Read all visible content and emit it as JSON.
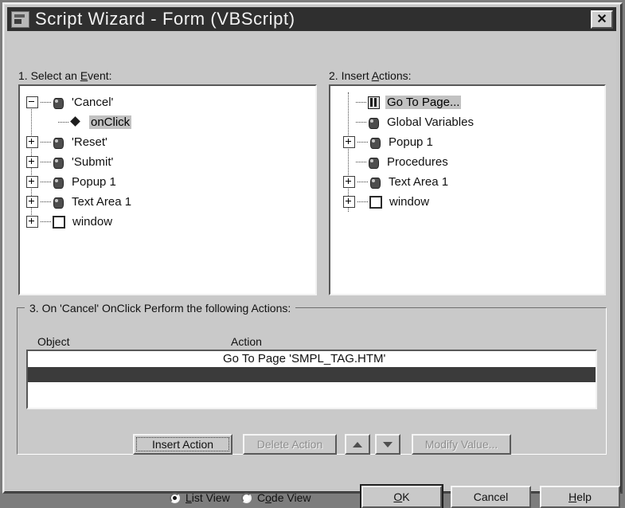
{
  "window": {
    "title": "Script Wizard - Form (VBScript)",
    "icon": "script-wizard-icon",
    "close_label": "✕"
  },
  "event_panel": {
    "label_prefix": "1. Select an ",
    "label_accel": "E",
    "label_suffix": "vent:",
    "tree": [
      {
        "label": "'Cancel'",
        "icon": "object-icon",
        "expander": "minus",
        "indent": 0,
        "selected": false
      },
      {
        "label": "onClick",
        "icon": "event-icon",
        "expander": "none",
        "indent": 1,
        "selected": true
      },
      {
        "label": "'Reset'",
        "icon": "object-icon",
        "expander": "plus",
        "indent": 0,
        "selected": false
      },
      {
        "label": "'Submit'",
        "icon": "object-icon",
        "expander": "plus",
        "indent": 0,
        "selected": false
      },
      {
        "label": "Popup 1",
        "icon": "object-icon",
        "expander": "plus",
        "indent": 0,
        "selected": false
      },
      {
        "label": "Text Area 1",
        "icon": "object-icon",
        "expander": "plus",
        "indent": 0,
        "selected": false
      },
      {
        "label": "window",
        "icon": "window-icon",
        "expander": "plus",
        "indent": 0,
        "selected": false
      }
    ]
  },
  "action_panel": {
    "label_prefix": "2. Insert ",
    "label_accel": "A",
    "label_suffix": "ctions:",
    "tree": [
      {
        "label": "Go To Page...",
        "icon": "page-icon",
        "expander": "none",
        "indent": 0,
        "selected": true
      },
      {
        "label": "Global Variables",
        "icon": "object-icon",
        "expander": "none",
        "indent": 0,
        "selected": false
      },
      {
        "label": "Popup 1",
        "icon": "object-icon",
        "expander": "plus",
        "indent": 0,
        "selected": false
      },
      {
        "label": "Procedures",
        "icon": "object-icon",
        "expander": "none",
        "indent": 0,
        "selected": false
      },
      {
        "label": "Text Area 1",
        "icon": "object-icon",
        "expander": "plus",
        "indent": 0,
        "selected": false
      },
      {
        "label": "window",
        "icon": "window-icon",
        "expander": "plus",
        "indent": 0,
        "selected": false
      }
    ]
  },
  "actions_group": {
    "title": "3. On 'Cancel' OnClick Perform the following Actions:",
    "columns": {
      "object": "Object",
      "action": "Action"
    },
    "rows": [
      {
        "object": "",
        "action": "Go To Page 'SMPL_TAG.HTM'",
        "selected": false
      },
      {
        "object": "",
        "action": "",
        "selected": true
      }
    ],
    "buttons": {
      "insert_action": {
        "label": "Insert Action",
        "disabled": false,
        "focused": true
      },
      "delete_action": {
        "label": "Delete Action",
        "disabled": true,
        "focused": false
      },
      "move_up": {
        "label": "move-up-arrow",
        "disabled": false,
        "focused": false
      },
      "move_down": {
        "label": "move-down-arrow",
        "disabled": false,
        "focused": false
      },
      "modify_value": {
        "label": "Modify Value...",
        "disabled": true,
        "focused": false
      }
    }
  },
  "footer": {
    "view_mode": "List View",
    "radios": [
      {
        "prefix": "",
        "accel": "L",
        "suffix": "ist View",
        "checked": true
      },
      {
        "prefix": "C",
        "accel": "o",
        "suffix": "de View",
        "checked": false
      }
    ],
    "buttons": {
      "ok": {
        "prefix": "",
        "accel": "O",
        "suffix": "K",
        "default": true
      },
      "cancel": {
        "prefix": "Cancel",
        "accel": "",
        "suffix": "",
        "default": false
      },
      "help": {
        "prefix": "",
        "accel": "H",
        "suffix": "elp",
        "default": false
      }
    }
  },
  "colors": {
    "face": "#c9c9c9",
    "titlebar": "#2f2f2f",
    "titlebar_text": "#f2f2f2",
    "selection_bar": "#3b3b3b",
    "tree_selection": "#c2c2c2",
    "field_bg": "#ffffff"
  }
}
